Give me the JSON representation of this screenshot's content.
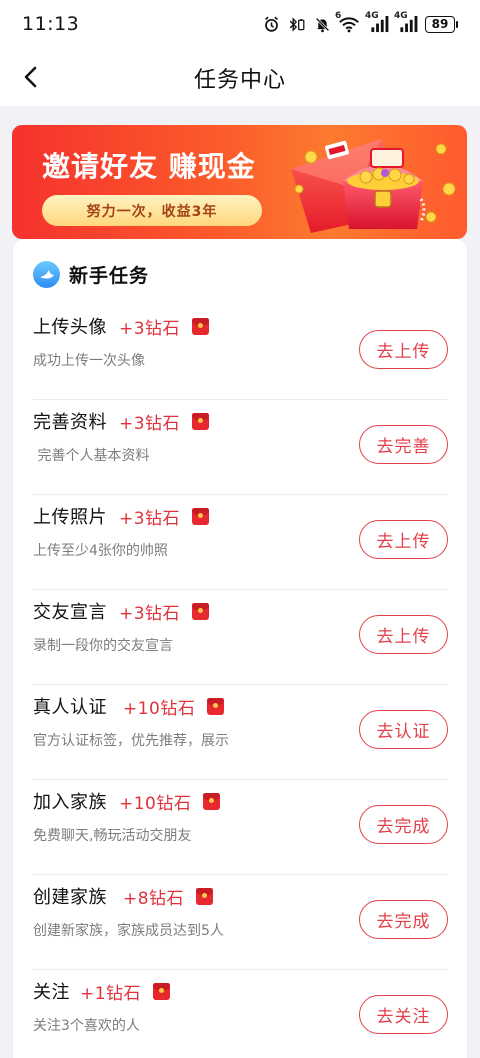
{
  "status_bar": {
    "time": "11:13",
    "battery": "89",
    "network_1": "4G",
    "network_2": "4G",
    "wifi_label": "6"
  },
  "header": {
    "title": "任务中心"
  },
  "banner": {
    "title": "邀请好友 赚现金",
    "pill_text": "努力一次，收益3年",
    "colors": {
      "start": "#f6322d",
      "end": "#fd7a2f",
      "pill": "#ffd77d"
    }
  },
  "section": {
    "title": "新手任务"
  },
  "accent_color": "#e2414a",
  "tasks": [
    {
      "name": "上传头像",
      "reward": "+3钻石",
      "desc": "成功上传一次头像",
      "action": "去上传"
    },
    {
      "name": "完善资料",
      "reward": "+3钻石",
      "desc": " 完善个人基本资料",
      "action": "去完善"
    },
    {
      "name": "上传照片",
      "reward": "+3钻石",
      "desc": "上传至少4张你的帅照",
      "action": "去上传"
    },
    {
      "name": "交友宣言",
      "reward": "+3钻石",
      "desc": "录制一段你的交友宣言",
      "action": "去上传"
    },
    {
      "name": "真人认证",
      "reward": "+10钻石",
      "desc": "官方认证标签，优先推荐，展示",
      "action": "去认证"
    },
    {
      "name": "加入家族",
      "reward": "+10钻石",
      "desc": "免费聊天,畅玩活动交朋友",
      "action": "去完成"
    },
    {
      "name": "创建家族",
      "reward": "+8钻石",
      "desc": "创建新家族，家族成员达到5人",
      "action": "去完成"
    },
    {
      "name": "关注",
      "reward": "+1钻石",
      "desc": "关注3个喜欢的人",
      "action": "去关注"
    }
  ]
}
